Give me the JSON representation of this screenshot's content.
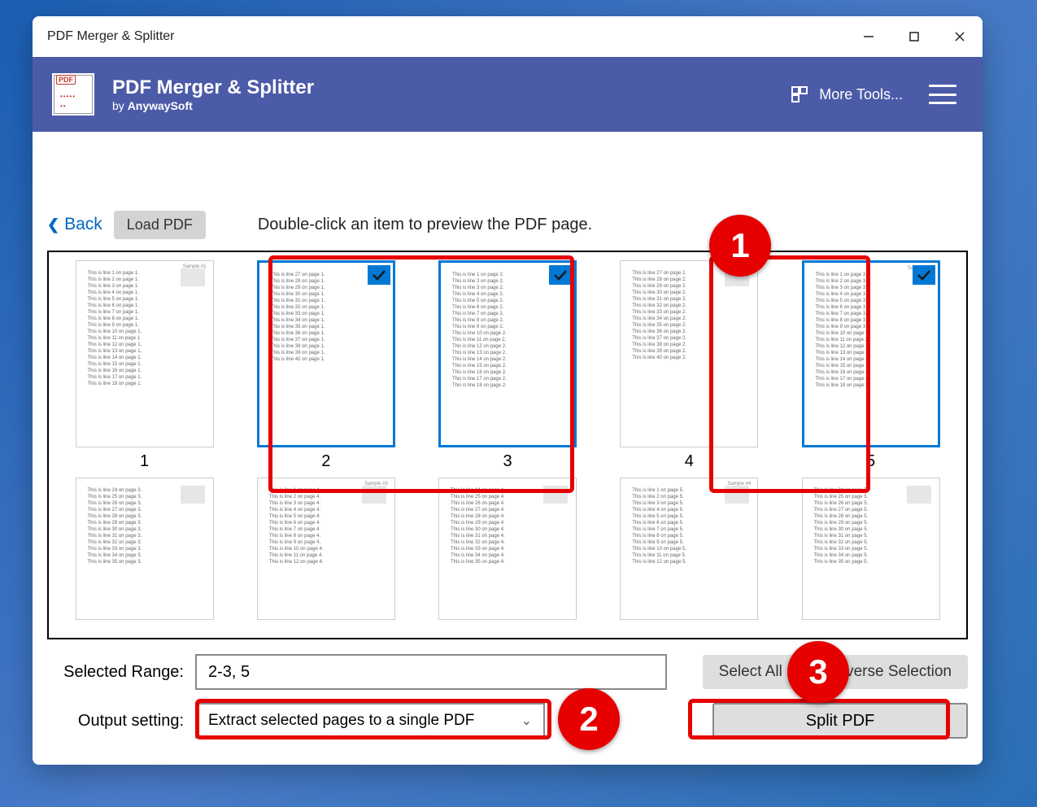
{
  "titlebar": {
    "title": "PDF Merger & Splitter"
  },
  "header": {
    "title": "PDF Merger & Splitter",
    "by": "by",
    "vendor": "AnywaySoft",
    "more_tools": "More Tools..."
  },
  "toolbar": {
    "back": "Back",
    "load": "Load PDF",
    "hint": "Double-click an item to preview the PDF page."
  },
  "pages_row1": [
    {
      "num": "1",
      "selected": false,
      "header": "Sample #1",
      "lineprefix": "This is line",
      "linepage": "on page 1.",
      "count": 18
    },
    {
      "num": "2",
      "selected": true,
      "header": "",
      "lineprefix": "This is line",
      "linepage": "on page 1.",
      "startn": 27,
      "count": 14
    },
    {
      "num": "3",
      "selected": true,
      "header": "",
      "lineprefix": "This is line",
      "linepage": "on page 2.",
      "count": 18
    },
    {
      "num": "4",
      "selected": false,
      "header": "",
      "lineprefix": "This is line",
      "linepage": "on page 2.",
      "startn": 27,
      "count": 14
    },
    {
      "num": "5",
      "selected": true,
      "header": "Sample #2",
      "lineprefix": "This is line",
      "linepage": "on page 3.",
      "count": 18
    }
  ],
  "pages_row2": [
    {
      "lineprefix": "This is line",
      "linepage": "on page 3.",
      "startn": 24,
      "count": 12,
      "header": ""
    },
    {
      "lineprefix": "This is line",
      "linepage": "on page 4.",
      "count": 12,
      "header": "Sample #3"
    },
    {
      "lineprefix": "This is line",
      "linepage": "on page 4.",
      "startn": 24,
      "count": 12,
      "header": ""
    },
    {
      "lineprefix": "This is line",
      "linepage": "on page 5.",
      "count": 12,
      "header": "Sample #4"
    },
    {
      "lineprefix": "This is line",
      "linepage": "on page 5.",
      "startn": 24,
      "count": 12,
      "header": ""
    }
  ],
  "form": {
    "selected_range_label": "Selected Range:",
    "selected_range_value": "2-3, 5",
    "output_label": "Output setting:",
    "output_value": "Extract selected pages to a single PDF",
    "select_all": "Select All",
    "reverse": "Reverse Selection",
    "split": "Split PDF"
  },
  "annotations": {
    "one": "1",
    "two": "2",
    "three": "3"
  }
}
